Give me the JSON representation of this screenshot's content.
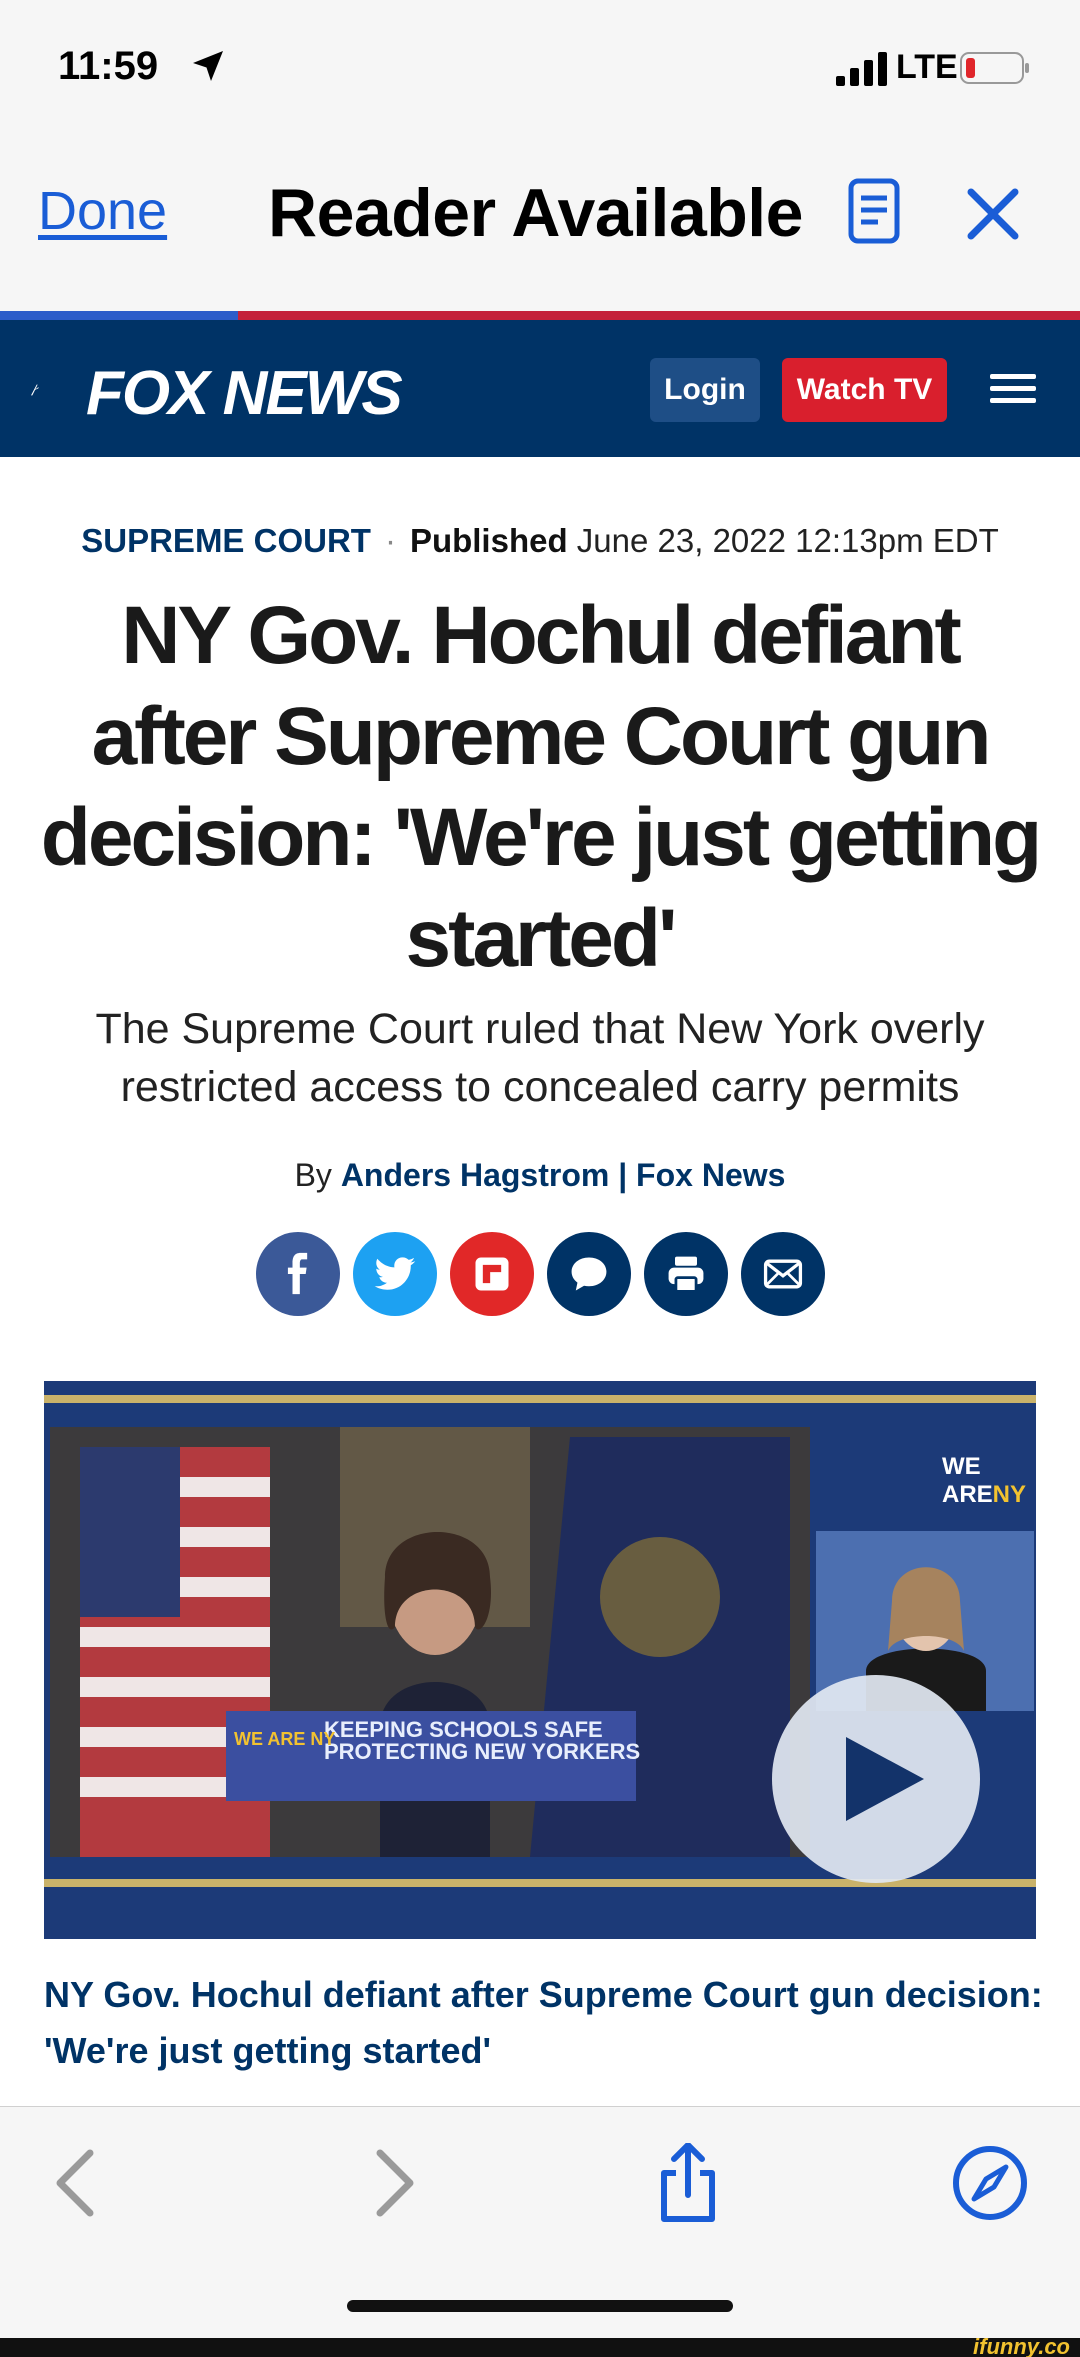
{
  "status_bar": {
    "time": "11:59",
    "network": "LTE"
  },
  "reader_bar": {
    "done_label": "Done",
    "title": "Reader Available",
    "progress_fraction": 0.22
  },
  "fox_header": {
    "logo_text": "FOX NEWS",
    "login_label": "Login",
    "watch_label": "Watch TV"
  },
  "article": {
    "section": "SUPREME COURT",
    "published_label": "Published",
    "published_date": "June 23, 2022 12:13pm EDT",
    "headline": "NY Gov. Hochul defiant after Supreme Court gun decision: 'We're just getting started'",
    "subheadline": "The Supreme Court ruled that New York overly restricted access to concealed carry permits",
    "by_label": "By",
    "author": "Anders Hagstrom",
    "separator": "|",
    "outlet": "Fox News"
  },
  "share_buttons": [
    {
      "icon": "facebook-icon",
      "color": "#3b5998"
    },
    {
      "icon": "twitter-icon",
      "color": "#1da1f2"
    },
    {
      "icon": "flipboard-icon",
      "color": "#e12828"
    },
    {
      "icon": "comment-icon",
      "color": "#003366"
    },
    {
      "icon": "print-icon",
      "color": "#003366"
    },
    {
      "icon": "email-icon",
      "color": "#003366"
    }
  ],
  "video": {
    "podium_line1": "KEEPING SCHOOLS SAFE",
    "podium_line2": "PROTECTING NEW YORKERS",
    "podium_badge": "WE ARE NY",
    "brand_we_are": "WE ARE",
    "brand_ny": "NY",
    "caption": "NY Gov. Hochul defiant after Supreme Court gun decision: 'We're just getting started'"
  },
  "toolbar": {
    "icons": [
      "back-icon",
      "forward-icon",
      "share-icon",
      "compass-icon"
    ]
  },
  "watermark": "ifunny.co",
  "colors": {
    "fox_navy": "#003366",
    "fox_red": "#d91f2d",
    "ios_blue": "#1a5dd6"
  }
}
